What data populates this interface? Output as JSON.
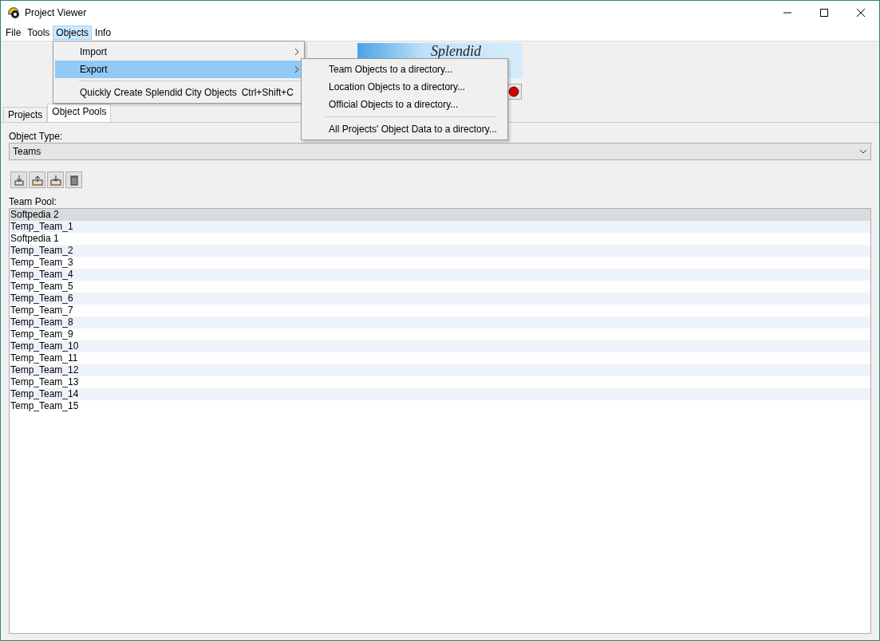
{
  "window": {
    "title": "Project Viewer"
  },
  "menubar": [
    {
      "label": "File",
      "selected": false
    },
    {
      "label": "Tools",
      "selected": false
    },
    {
      "label": "Objects",
      "selected": true
    },
    {
      "label": "Info",
      "selected": false
    }
  ],
  "menu": [
    {
      "kind": "submenu",
      "label": "Import",
      "selected": false
    },
    {
      "kind": "submenu",
      "label": "Export",
      "selected": true
    },
    {
      "kind": "separator"
    },
    {
      "kind": "item",
      "label": "Quickly Create Splendid City Objects",
      "shortcut": "Ctrl+Shift+C",
      "selected": false
    }
  ],
  "submenu": [
    {
      "kind": "item",
      "label": "Team Objects to a directory..."
    },
    {
      "kind": "item",
      "label": "Location Objects to a directory..."
    },
    {
      "kind": "item",
      "label": "Official Objects to a directory..."
    },
    {
      "kind": "separator"
    },
    {
      "kind": "item",
      "label": "All Projects' Object Data to a directory..."
    }
  ],
  "logo": {
    "text": "Splendid"
  },
  "tabs": [
    {
      "label": "Projects",
      "selected": false
    },
    {
      "label": "Object Pools",
      "selected": true
    }
  ],
  "object_type": {
    "label": "Object Type:",
    "value": "Teams"
  },
  "pool": {
    "label": "Team Pool:",
    "rows": [
      {
        "name": "Softpedia 2",
        "selected": true
      },
      {
        "name": "Temp_Team_1",
        "selected": false
      },
      {
        "name": "Softpedia 1",
        "selected": false
      },
      {
        "name": "Temp_Team_2",
        "selected": false
      },
      {
        "name": "Temp_Team_3",
        "selected": false
      },
      {
        "name": "Temp_Team_4",
        "selected": false
      },
      {
        "name": "Temp_Team_5",
        "selected": false
      },
      {
        "name": "Temp_Team_6",
        "selected": false
      },
      {
        "name": "Temp_Team_7",
        "selected": false
      },
      {
        "name": "Temp_Team_8",
        "selected": false
      },
      {
        "name": "Temp_Team_9",
        "selected": false
      },
      {
        "name": "Temp_Team_10",
        "selected": false
      },
      {
        "name": "Temp_Team_11",
        "selected": false
      },
      {
        "name": "Temp_Team_12",
        "selected": false
      },
      {
        "name": "Temp_Team_13",
        "selected": false
      },
      {
        "name": "Temp_Team_14",
        "selected": false
      },
      {
        "name": "Temp_Team_15",
        "selected": false
      }
    ]
  }
}
